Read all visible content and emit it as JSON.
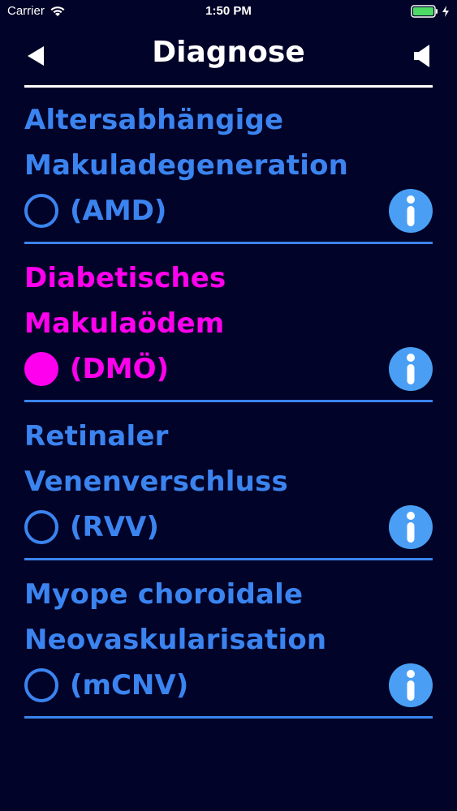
{
  "status_bar": {
    "carrier": "Carrier",
    "time": "1:50 PM",
    "wifi_icon": "wifi-icon",
    "battery_icon": "battery-icon"
  },
  "nav": {
    "title": "Diagnose",
    "back_icon": "back-arrow-icon",
    "speaker_icon": "speaker-icon"
  },
  "colors": {
    "background": "#020328",
    "accent": "#3b84f0",
    "selected": "#ff00ee",
    "info": "#4a9ff5"
  },
  "diagnoses": [
    {
      "name_lines": [
        "Altersabhängige",
        "Makuladegeneration"
      ],
      "abbr": "(AMD)",
      "selected": false
    },
    {
      "name_lines": [
        "Diabetisches Makulaödem"
      ],
      "abbr": "(DMÖ)",
      "selected": true
    },
    {
      "name_lines": [
        "Retinaler Venenverschluss"
      ],
      "abbr": "(RVV)",
      "selected": false
    },
    {
      "name_lines": [
        "Myope choroidale",
        "Neovaskularisation"
      ],
      "abbr": "(mCNV)",
      "selected": false
    }
  ]
}
